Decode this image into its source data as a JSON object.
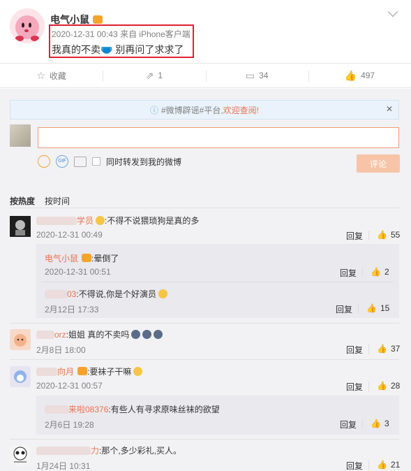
{
  "post": {
    "author": "电气小鼠",
    "meta": "2020-12-31 00:43 来自 iPhone客户端",
    "text": "我真的不卖🩲 别再问了求求了"
  },
  "actions": {
    "favorite_label": "收藏",
    "forward_count": "1",
    "comment_count": "34",
    "like_count": "497"
  },
  "notice": {
    "prefix": "#微博辟谣#平台,",
    "link": "欢迎查阅!",
    "close": "✕"
  },
  "composer": {
    "forward_label": "同时转发到我的微博",
    "submit_label": "评论"
  },
  "sort": {
    "hot": "按热度",
    "time": "按时间"
  },
  "comments": [
    {
      "name_tail": "学员",
      "text": ":不得不说猥琐狗是真的多",
      "date": "2020-12-31 00:49",
      "reply": "回复",
      "likes": "55",
      "replies": [
        {
          "name": "电气小鼠",
          "text": ":晕倒了",
          "date": "2020-12-31 00:51",
          "reply": "回复",
          "likes": "2"
        },
        {
          "name_tail": "03",
          "text": ":不得说,你是个好演员",
          "date": "2月12日 17:33",
          "reply": "回复",
          "likes": "15"
        }
      ]
    },
    {
      "name_tail": "orz",
      "text": ":姐姐 真的不卖吗",
      "date": "2月8日 18:00",
      "reply": "回复",
      "likes": "37"
    },
    {
      "name_tail": "向月",
      "text": ":要袜子干嘛",
      "date": "2020-12-31 00:57",
      "reply": "回复",
      "likes": "28",
      "replies": [
        {
          "name_tail": "来啦08376",
          "text": ":有些人有寻求原味丝袜的欲望",
          "date": "2月6日 19:28",
          "reply": "回复",
          "likes": "3"
        }
      ]
    },
    {
      "name_tail": "力",
      "text": ":那个,多少彩礼,买人。",
      "date": "1月24日 10:31",
      "reply": "回复",
      "likes": "21"
    }
  ],
  "colors": {
    "accent": "#eb7350",
    "highlight_border": "#e0202e",
    "comment_bg": "#f2f2f5",
    "sub_bg": "#e9e9ee"
  }
}
